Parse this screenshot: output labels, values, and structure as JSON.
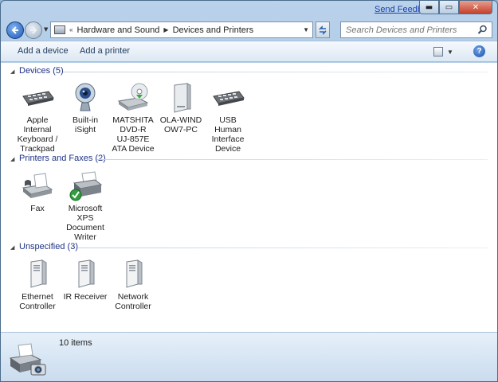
{
  "window": {
    "send_feedback": "Send Feedback",
    "minimize": "▬",
    "maximize": "▭",
    "close": "✕"
  },
  "address": {
    "crumbs": [
      "Hardware and Sound",
      "Devices and Printers"
    ],
    "search_placeholder": "Search Devices and Printers"
  },
  "toolbar": {
    "add_device": "Add a device",
    "add_printer": "Add a printer",
    "help": "?"
  },
  "groups": [
    {
      "title": "Devices (5)",
      "items": [
        {
          "label": "Apple\nInternal\nKeyboard /\nTrackpad",
          "icon": "keyboard-icon"
        },
        {
          "label": "Built-in\niSight",
          "icon": "webcam-icon"
        },
        {
          "label": "MATSHITA\nDVD-R\nUJ-857E\nATA Device",
          "icon": "dvd-drive-icon"
        },
        {
          "label": "OLA-WIND\nOW7-PC",
          "icon": "computer-tower-icon"
        },
        {
          "label": "USB\nHuman\nInterface\nDevice",
          "icon": "keyboard-icon"
        }
      ]
    },
    {
      "title": "Printers and Faxes (2)",
      "items": [
        {
          "label": "Fax",
          "icon": "fax-icon"
        },
        {
          "label": "Microsoft\nXPS\nDocument\nWriter",
          "icon": "printer-default-icon"
        }
      ]
    },
    {
      "title": "Unspecified (3)",
      "items": [
        {
          "label": "Ethernet\nController",
          "icon": "generic-device-icon"
        },
        {
          "label": "IR Receiver",
          "icon": "generic-device-icon"
        },
        {
          "label": "Network\nController",
          "icon": "generic-device-icon"
        }
      ]
    }
  ],
  "details": {
    "count": "10 items"
  },
  "colors": {
    "group_title": "#1e3287",
    "link": "#1a3fa8"
  }
}
